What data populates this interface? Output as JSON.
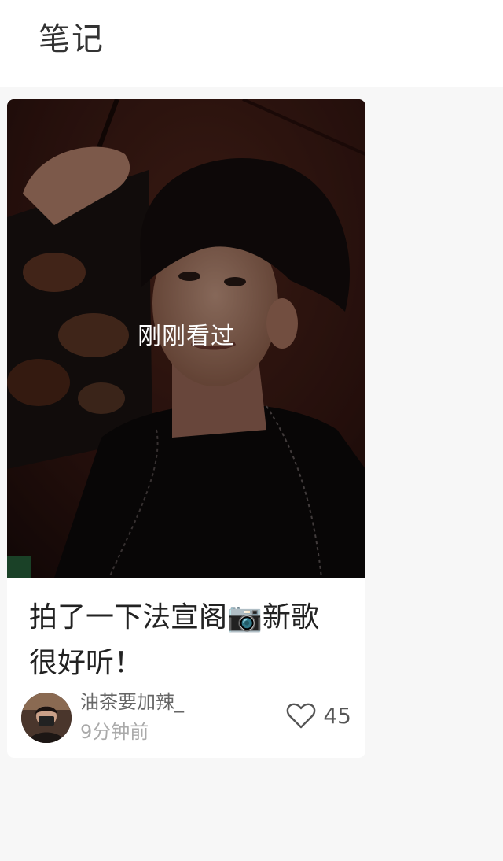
{
  "header": {
    "title": "笔记"
  },
  "note": {
    "cover_label": "刚刚看过",
    "title_part1": "拍了一下法宣阁",
    "camera_icon": "camera-icon",
    "title_part2": "新歌很好听！",
    "author": {
      "name": "油茶要加辣_",
      "time": "9分钟前"
    },
    "likes": "45"
  }
}
